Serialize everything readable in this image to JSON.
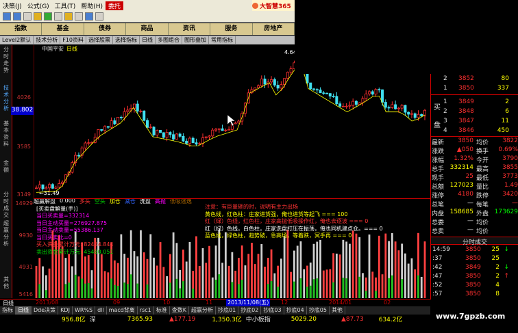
{
  "menu": [
    "决策(J)",
    "公式(G)",
    "工具(T)",
    "帮助(H)",
    "委托"
  ],
  "brand": "大智慧365",
  "cat_tabs": [
    "指数",
    "基金",
    "债券",
    "商品",
    "资讯",
    "服务",
    "房地产"
  ],
  "func_tabs": [
    "Level2默认",
    "技术分析",
    "F10资料",
    "选择股票",
    "选择指标",
    "日线",
    "多图组合",
    "图形叠加",
    "常用指标"
  ],
  "vtabs": [
    "分时走势",
    "技术分析",
    "基本资料",
    "金额",
    "分时成交",
    "超赢分析",
    "其他"
  ],
  "stock_name": "中国平安",
  "period": "日线",
  "price_axis": [
    "4026",
    "3585",
    "3149",
    "38.802"
  ],
  "high_label": "4.64",
  "low_label": "←31.49",
  "indicator_bar": {
    "name": "超赢解盘",
    "value": "0.000",
    "items": [
      "多头",
      "空头",
      "加仓",
      "减仓",
      "洗盘",
      "高抛",
      "低吸逃逸"
    ]
  },
  "vol_axis": [
    "14929",
    "9930",
    "4931",
    "5416"
  ],
  "vol_title": "[买卖盘解量(手)]",
  "vol_stats": [
    "当日买卖量=332314",
    "当日主动买量=276927.875",
    "当日主动卖量=55386.137",
    "当日买卖比=0",
    "买入资金累计万元: 82454.844",
    "卖出资金累计万元: 45480.051"
  ],
  "notes": [
    "注意：有巨量砸的时，说明有主力出场",
    "黄色线，红色柱：庄家进货强，俺也进货等起飞 === 100",
    "红（绿）色线，红色柱，庄家高抛低吸操作红，俺也去逐波 === 0",
    "红（绿）色线，白色柱，庄家洗盘打压在振荡，俺也同机建点仓。=== 0",
    "蓝色线，绿色柱，趋势破，急高场，等着跌，冥手再 === 0"
  ],
  "date_labels": [
    "2013/08",
    "09",
    "10",
    "11",
    "2013/11/08(五)",
    "12",
    "2014/01",
    "02"
  ],
  "bottom_tabs": [
    "指标",
    "日线",
    "Dde决策",
    "KDJ",
    "WR%S",
    "dll",
    "macd背离",
    "rsc1",
    "标准",
    "查数K",
    "超赢分析",
    "抄底01",
    "抄底02",
    "抄底03",
    "抄底04",
    "抄底05",
    "其他"
  ],
  "status": {
    "a_val": "956.8亿",
    "a_name": "深",
    "b_val": "7365.93",
    "c_chg": "▲177.19",
    "d_val": "1,350.3亿",
    "d_name": "中小板指",
    "e_val": "5029.20",
    "f_chg": "▲87.73",
    "g_val": "634.2亿"
  },
  "order_book": {
    "sell": [
      {
        "lvl": "2",
        "px": "3852",
        "vol": "80"
      },
      {
        "lvl": "1",
        "px": "3850",
        "vol": "337"
      }
    ],
    "buy": [
      {
        "lvl": "1",
        "px": "3849",
        "vol": "2"
      },
      {
        "lvl": "2",
        "px": "3848",
        "vol": "6"
      },
      {
        "lvl": "3",
        "px": "3847",
        "vol": "11"
      },
      {
        "lvl": "4",
        "px": "3846",
        "vol": "450"
      }
    ],
    "buy_label_top": "买",
    "buy_label_bot": "盘",
    "buy_idx": [
      "3",
      "4",
      "5"
    ]
  },
  "stats": [
    {
      "k1": "最新",
      "v1": "3850",
      "k2": "均价",
      "v2": "3822"
    },
    {
      "k1": "涨跌",
      "v1": "▲050",
      "k2": "换手",
      "v2": "0.69%"
    },
    {
      "k1": "涨幅",
      "v1": "1.32%",
      "k2": "今开",
      "v2": "3790"
    },
    {
      "k1": "总手",
      "v1": "332314",
      "k2": "最高",
      "v2": "3855"
    },
    {
      "k1": "现手",
      "v1": "25",
      "k2": "最低",
      "v2": "3773"
    },
    {
      "k1": "总额",
      "v1": "127023",
      "k2": "量比",
      "v2": "1.49"
    },
    {
      "k1": "涨停",
      "v1": "4180",
      "k2": "跌停",
      "v2": "3420"
    },
    {
      "k1": "总笔",
      "v1": "—",
      "k2": "每笔",
      "v2": "—"
    },
    {
      "k1": "内盘",
      "v1": "158685",
      "k2": "外盘",
      "v2": "173629"
    },
    {
      "k1": "总委",
      "v1": "—",
      "k2": "均价",
      "v2": ""
    },
    {
      "k1": "总卖",
      "v1": "—",
      "k2": "均价",
      "v2": ""
    }
  ],
  "ticks_title": "分时成交",
  "ticks": [
    {
      "t": "14:59",
      "p": "3850",
      "v": "25",
      "d": "↓"
    },
    {
      "t": ":37",
      "p": "3850",
      "v": "25",
      "d": ""
    },
    {
      "t": ":42",
      "p": "3849",
      "v": "2",
      "d": "↓"
    },
    {
      "t": ":47",
      "p": "3850",
      "v": "2",
      "d": "↑"
    },
    {
      "t": ":52",
      "p": "3850",
      "v": "4",
      "d": ""
    },
    {
      "t": ":57",
      "p": "3850",
      "v": "8",
      "d": ""
    }
  ],
  "watermark": "www.7gpzb.com",
  "colors": {
    "up": "#ff3030",
    "down": "#00e0e0",
    "axis": "#c00000",
    "yellow": "#ffff00"
  }
}
